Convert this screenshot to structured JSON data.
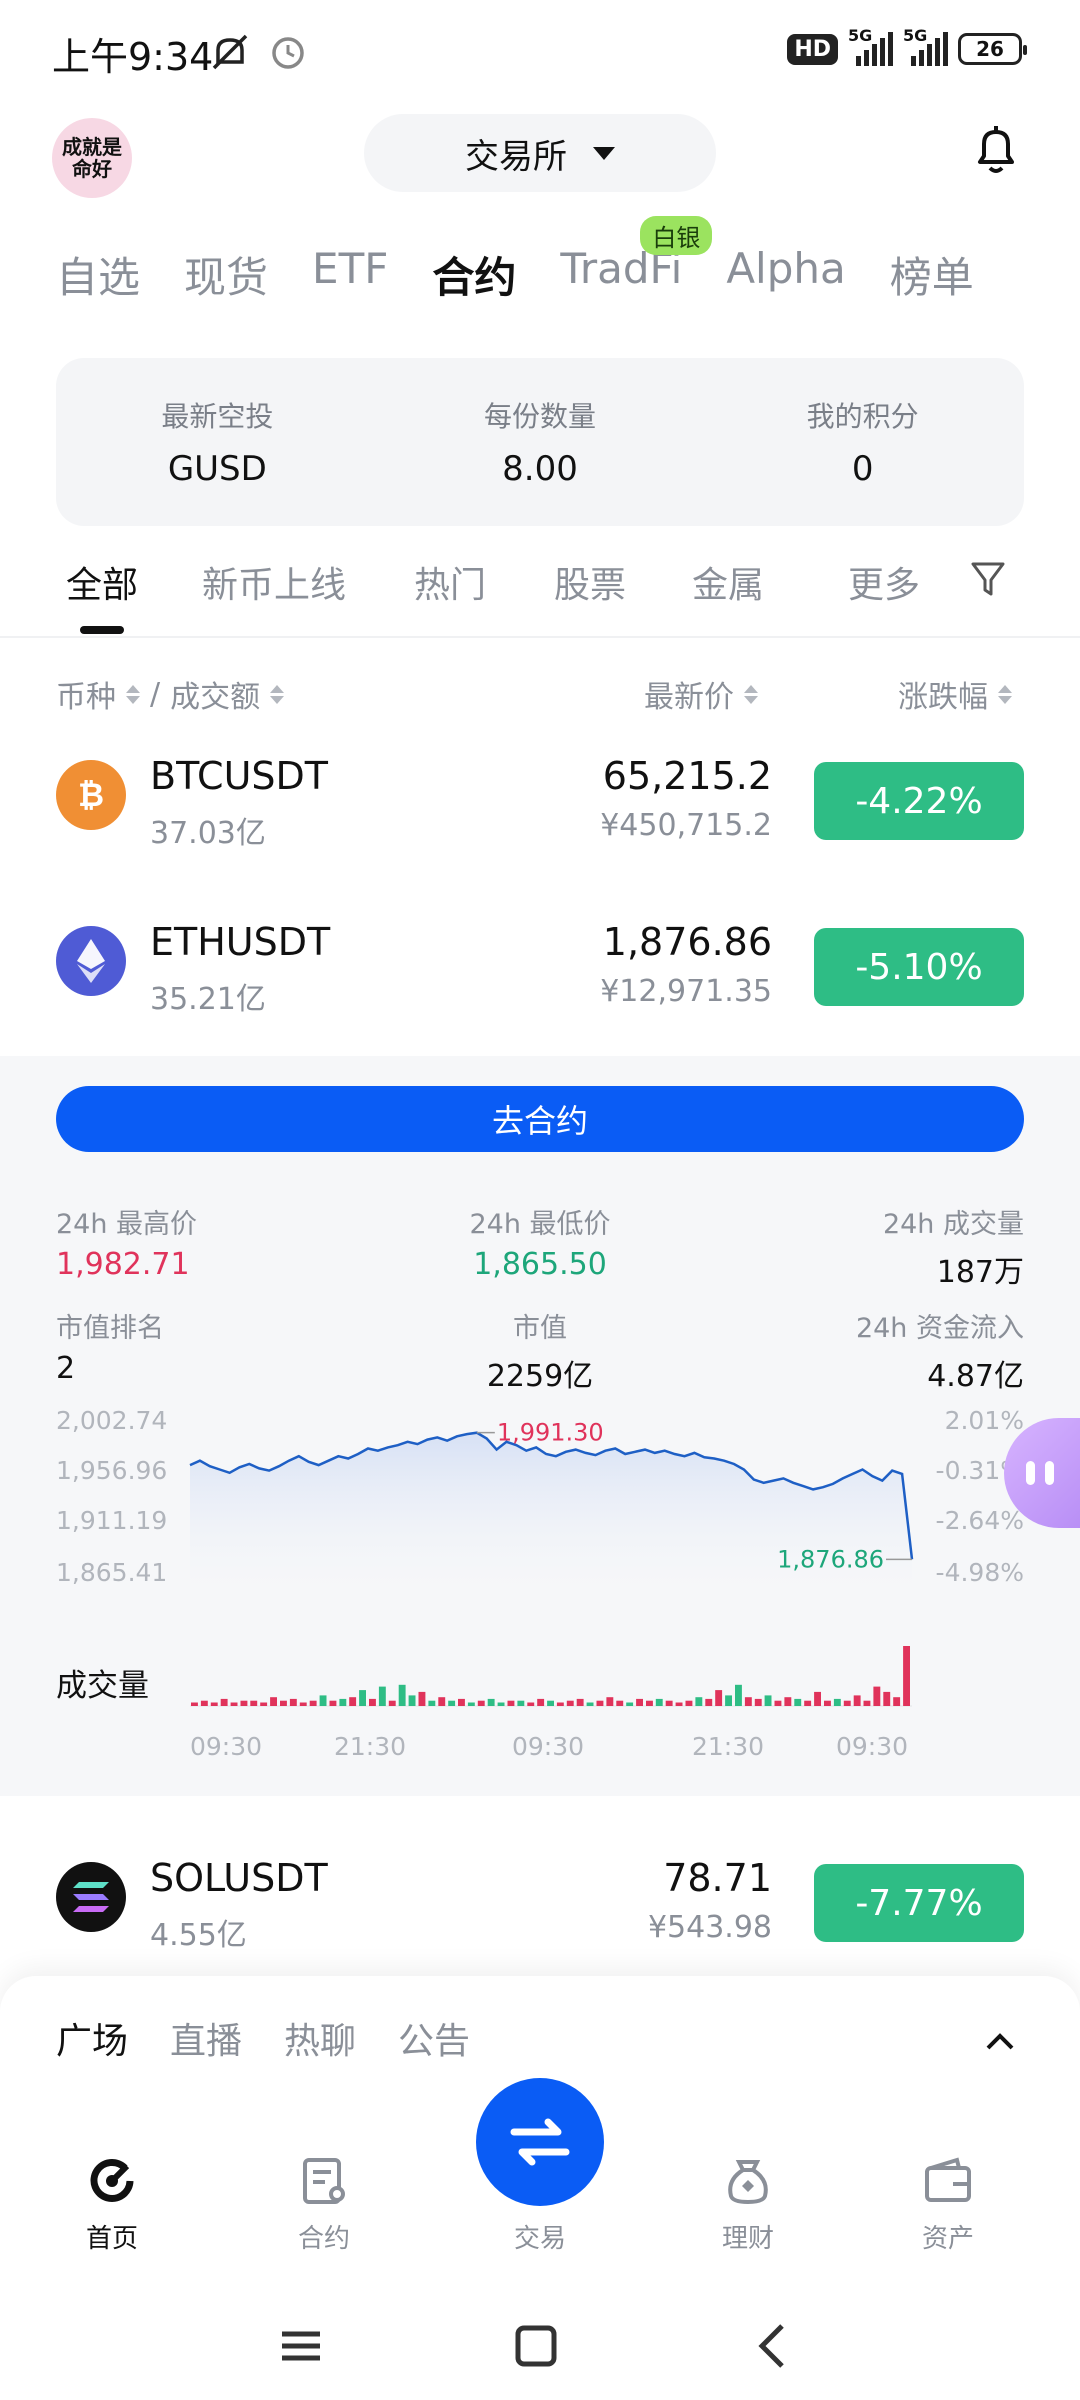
{
  "status_bar": {
    "time": "上午9:34",
    "hd": "HD",
    "sim1": "5G",
    "sim2": "5G",
    "battery": "26"
  },
  "header": {
    "avatar_text": [
      "成就是",
      "命好"
    ],
    "exchange_label": "交易所"
  },
  "top_tabs": [
    {
      "label": "自选",
      "active": false
    },
    {
      "label": "现货",
      "active": false
    },
    {
      "label": "ETF",
      "active": false
    },
    {
      "label": "合约",
      "active": true
    },
    {
      "label": "TradFi",
      "active": false,
      "badge": "白银"
    },
    {
      "label": "Alpha",
      "active": false
    },
    {
      "label": "榜单",
      "active": false
    }
  ],
  "airdrop": [
    {
      "label": "最新空投",
      "value": "GUSD"
    },
    {
      "label": "每份数量",
      "value": "8.00"
    },
    {
      "label": "我的积分",
      "value": "0"
    }
  ],
  "sub_tabs": [
    "全部",
    "新币上线",
    "热门",
    "股票",
    "金属",
    "更多"
  ],
  "list_header": {
    "pair": "币种",
    "sep": "/",
    "turnover": "成交额",
    "last": "最新价",
    "change": "涨跌幅"
  },
  "rows": [
    {
      "symbol": "BTCUSDT",
      "volume": "37.03亿",
      "price": "65,215.2",
      "cny": "¥450,715.2",
      "change": "-4.22%",
      "icon": "bitcoin-icon",
      "color": "#f08f34"
    },
    {
      "symbol": "ETHUSDT",
      "volume": "35.21亿",
      "price": "1,876.86",
      "cny": "¥12,971.35",
      "change": "-5.10%",
      "icon": "ethereum-icon",
      "color": "#4f5bd5"
    },
    {
      "symbol": "SOLUSDT",
      "volume": "4.55亿",
      "price": "78.71",
      "cny": "¥543.98",
      "change": "-7.77%",
      "icon": "solana-icon",
      "color": "#111111"
    }
  ],
  "detail": {
    "go_button": "去合约",
    "high_label": "24h 最高价",
    "high": "1,982.71",
    "low_label": "24h 最低价",
    "low": "1,865.50",
    "vol_label": "24h 成交量",
    "vol": "187万",
    "rank_label": "市值排名",
    "rank": "2",
    "cap_label": "市值",
    "cap": "2259亿",
    "inflow_label": "24h 资金流入",
    "inflow": "4.87亿"
  },
  "chart_data": {
    "type": "line",
    "y_ticks": [
      "2,002.74",
      "1,956.96",
      "1,911.19",
      "1,865.41"
    ],
    "pct_ticks": [
      "2.01%",
      "-0.31%",
      "-2.64%",
      "-4.98%"
    ],
    "x_ticks": [
      "09:30",
      "21:30",
      "09:30",
      "21:30",
      "09:30"
    ],
    "ylim": [
      1865.41,
      2002.74
    ],
    "max_label": "1,991.30",
    "last_label": "1,876.86",
    "prices": [
      1962,
      1966,
      1961,
      1958,
      1955,
      1960,
      1963,
      1959,
      1957,
      1961,
      1966,
      1970,
      1965,
      1962,
      1966,
      1970,
      1968,
      1972,
      1977,
      1975,
      1978,
      1980,
      1983,
      1981,
      1985,
      1987,
      1984,
      1988,
      1990,
      1991.3,
      1986,
      1976,
      1983,
      1980,
      1975,
      1978,
      1972,
      1970,
      1974,
      1976,
      1973,
      1971,
      1975,
      1977,
      1972,
      1974,
      1976,
      1973,
      1975,
      1972,
      1970,
      1973,
      1969,
      1968,
      1966,
      1963,
      1958,
      1949,
      1946,
      1948,
      1950,
      1946,
      1943,
      1940,
      1942,
      1945,
      1950,
      1954,
      1958,
      1952,
      1948,
      1957,
      1954,
      1876.86
    ],
    "volume_label": "成交量",
    "volumes": [
      2,
      3,
      2,
      4,
      2,
      3,
      3,
      2,
      5,
      3,
      4,
      2,
      3,
      6,
      3,
      4,
      5,
      9,
      4,
      11,
      3,
      12,
      6,
      8,
      3,
      5,
      3,
      4,
      2,
      3,
      4,
      2,
      3,
      3,
      2,
      4,
      3,
      2,
      3,
      4,
      2,
      3,
      5,
      3,
      2,
      4,
      3,
      4,
      3,
      2,
      3,
      5,
      4,
      9,
      6,
      12,
      5,
      4,
      6,
      3,
      5,
      4,
      3,
      8,
      3,
      4,
      3,
      6,
      3,
      11,
      8,
      5,
      34
    ],
    "volume_colors_up": [
      0,
      0,
      0,
      0,
      0,
      0,
      0,
      0,
      0,
      0,
      0,
      0,
      0,
      1,
      0,
      1,
      0,
      1,
      0,
      1,
      0,
      1,
      1,
      0,
      1,
      0,
      1,
      0,
      1,
      0,
      1,
      1,
      0,
      1,
      0,
      0,
      1,
      0,
      0,
      0,
      1,
      0,
      0,
      0,
      1,
      0,
      0,
      1,
      0,
      0,
      0,
      1,
      0,
      0,
      1,
      1,
      0,
      0,
      1,
      0,
      0,
      1,
      0,
      0,
      0,
      1,
      0,
      0,
      0,
      0,
      0,
      0,
      0
    ]
  },
  "bottom_sheet": {
    "tabs": [
      "广场",
      "直播",
      "热聊",
      "公告"
    ]
  },
  "nav": [
    {
      "label": "首页",
      "icon": "home-icon",
      "active": true
    },
    {
      "label": "合约",
      "icon": "contract-icon",
      "active": false
    },
    {
      "label": "交易",
      "icon": "trade-icon",
      "active": false
    },
    {
      "label": "理财",
      "icon": "earn-icon",
      "active": false
    },
    {
      "label": "资产",
      "icon": "wallet-icon",
      "active": false
    }
  ],
  "colors": {
    "accent": "#0a5cf5",
    "down_green": "#2ebd85",
    "red": "#e0335b",
    "line": "#1e5fc5"
  }
}
